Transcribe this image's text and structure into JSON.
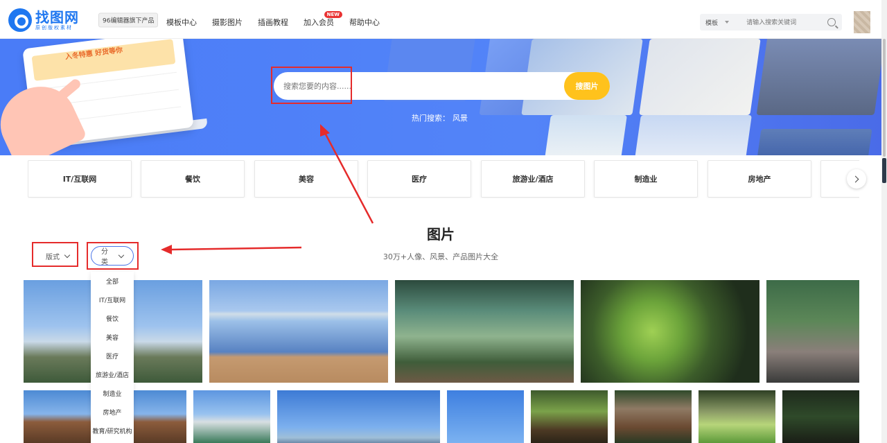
{
  "header": {
    "logo_name": "找图网",
    "logo_sub": "原创版权素材",
    "tagline": "96编辑器旗下产品",
    "nav": [
      {
        "label": "模板中心"
      },
      {
        "label": "摄影图片"
      },
      {
        "label": "插画教程"
      },
      {
        "label": "加入会员",
        "badge": "NEW"
      },
      {
        "label": "帮助中心"
      }
    ],
    "search_type": "模板",
    "search_placeholder": "请输入搜索关键词"
  },
  "banner": {
    "laptop_title": "入冬特惠 好货等你",
    "search_placeholder": "搜索您要的内容......",
    "search_button": "搜图片",
    "hot_label": "热门搜索：",
    "hot_link": "风景"
  },
  "categories": [
    "IT/互联网",
    "餐饮",
    "美容",
    "医疗",
    "旅游业/酒店",
    "制造业",
    "房地产"
  ],
  "section": {
    "title": "图片",
    "subtitle": "30万+人像、风景、产品图片大全"
  },
  "filters": {
    "layout_label": "版式",
    "category_label": "分类"
  },
  "dropdown": [
    "全部",
    "IT/互联网",
    "餐饮",
    "美容",
    "医疗",
    "旅游业/酒店",
    "制造业",
    "房地产",
    "教育/研究机构"
  ],
  "colors": {
    "brand": "#1f77f0",
    "banner": "#4a7cf7",
    "search_button": "#ffc21c",
    "annotation": "#e52b2b"
  }
}
